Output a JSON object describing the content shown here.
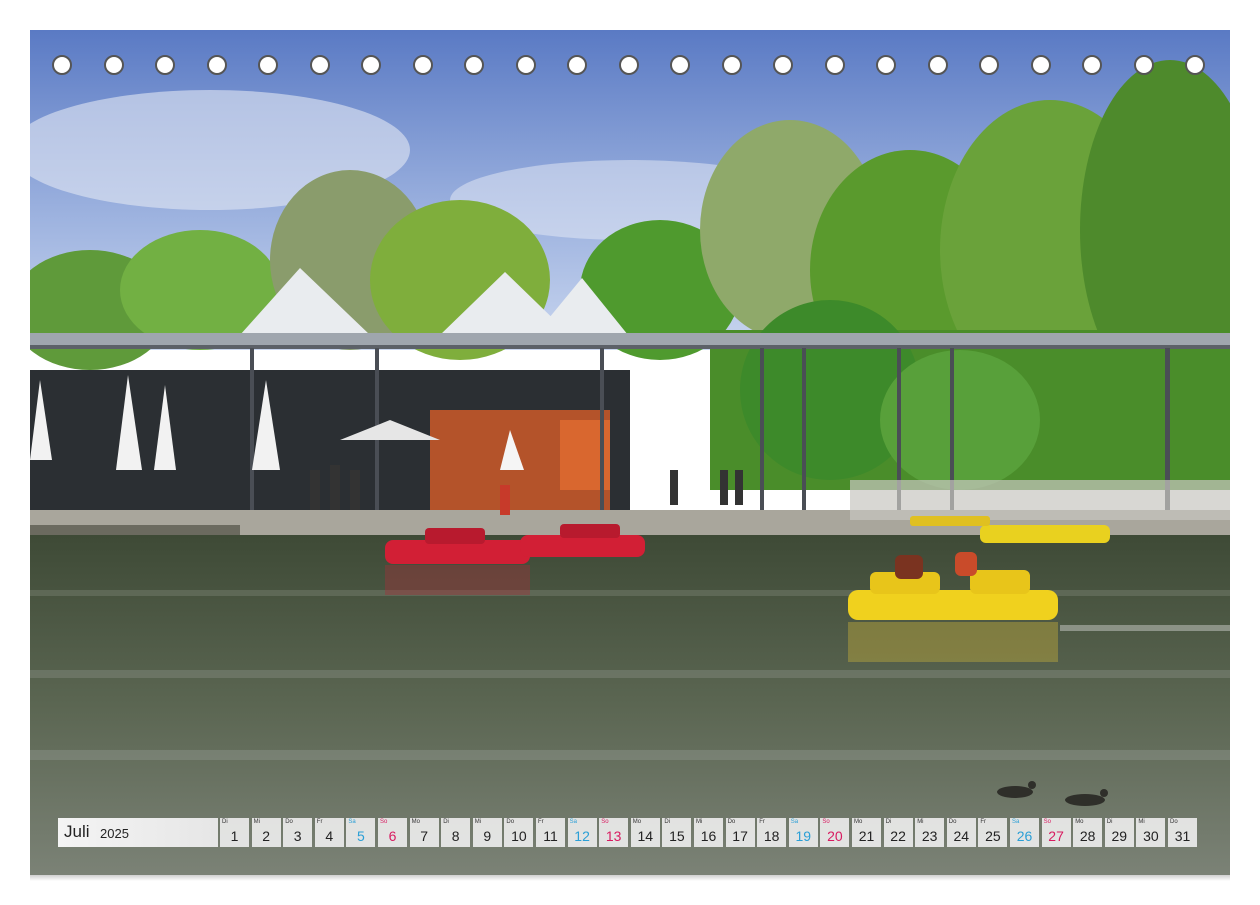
{
  "calendar": {
    "month": "Juli",
    "year": "2025",
    "days": [
      {
        "wd": "Di",
        "num": "1",
        "type": "weekday"
      },
      {
        "wd": "Mi",
        "num": "2",
        "type": "weekday"
      },
      {
        "wd": "Do",
        "num": "3",
        "type": "weekday"
      },
      {
        "wd": "Fr",
        "num": "4",
        "type": "weekday"
      },
      {
        "wd": "Sa",
        "num": "5",
        "type": "sat"
      },
      {
        "wd": "So",
        "num": "6",
        "type": "sun"
      },
      {
        "wd": "Mo",
        "num": "7",
        "type": "weekday"
      },
      {
        "wd": "Di",
        "num": "8",
        "type": "weekday"
      },
      {
        "wd": "Mi",
        "num": "9",
        "type": "weekday"
      },
      {
        "wd": "Do",
        "num": "10",
        "type": "weekday"
      },
      {
        "wd": "Fr",
        "num": "11",
        "type": "weekday"
      },
      {
        "wd": "Sa",
        "num": "12",
        "type": "sat"
      },
      {
        "wd": "So",
        "num": "13",
        "type": "sun"
      },
      {
        "wd": "Mo",
        "num": "14",
        "type": "weekday"
      },
      {
        "wd": "Di",
        "num": "15",
        "type": "weekday"
      },
      {
        "wd": "Mi",
        "num": "16",
        "type": "weekday"
      },
      {
        "wd": "Do",
        "num": "17",
        "type": "weekday"
      },
      {
        "wd": "Fr",
        "num": "18",
        "type": "weekday"
      },
      {
        "wd": "Sa",
        "num": "19",
        "type": "sat"
      },
      {
        "wd": "So",
        "num": "20",
        "type": "sun"
      },
      {
        "wd": "Mo",
        "num": "21",
        "type": "weekday"
      },
      {
        "wd": "Di",
        "num": "22",
        "type": "weekday"
      },
      {
        "wd": "Mi",
        "num": "23",
        "type": "weekday"
      },
      {
        "wd": "Do",
        "num": "24",
        "type": "weekday"
      },
      {
        "wd": "Fr",
        "num": "25",
        "type": "weekday"
      },
      {
        "wd": "Sa",
        "num": "26",
        "type": "sat"
      },
      {
        "wd": "So",
        "num": "27",
        "type": "sun"
      },
      {
        "wd": "Mo",
        "num": "28",
        "type": "weekday"
      },
      {
        "wd": "Di",
        "num": "29",
        "type": "weekday"
      },
      {
        "wd": "Mi",
        "num": "30",
        "type": "weekday"
      },
      {
        "wd": "Do",
        "num": "31",
        "type": "weekday"
      }
    ]
  },
  "colors": {
    "saturday": "#2a9fd6",
    "sunday": "#d81b60",
    "sky": "#6f8fd0",
    "water": "#4d5a44"
  },
  "binding": {
    "hole_count": 23
  },
  "photo": {
    "subject": "lake-pavilion-pedal-boats-scene"
  }
}
